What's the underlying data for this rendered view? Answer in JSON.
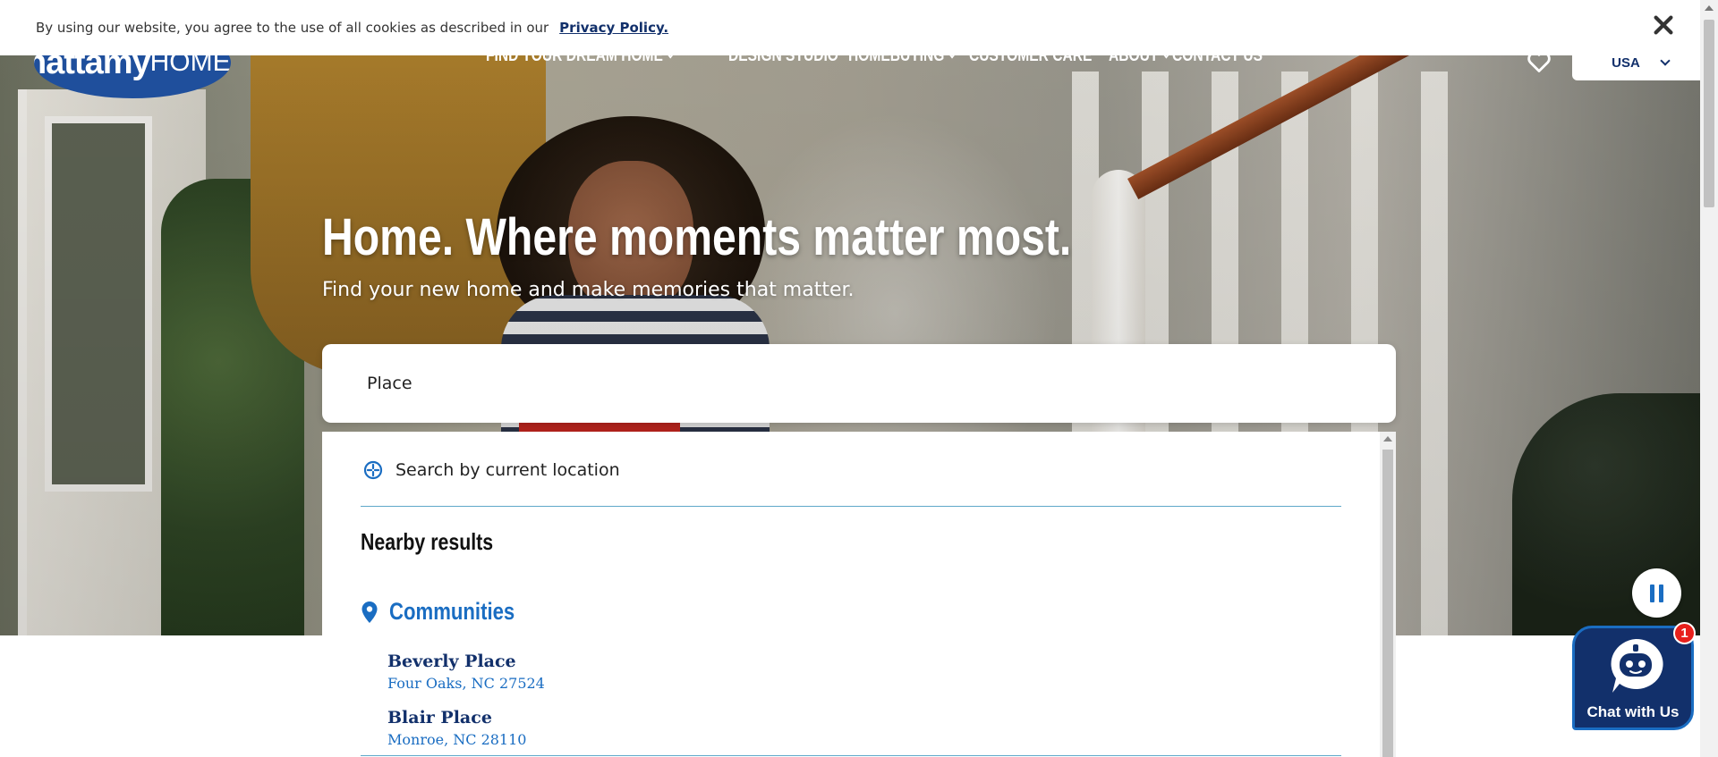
{
  "cookie_bar": {
    "message": "By using our website, you agree to the use of all cookies as described in our",
    "link_text": "Privacy Policy."
  },
  "header": {
    "logo_text_main": "mattamy",
    "logo_text_sub": "HOMES",
    "nav": [
      {
        "label": "FIND YOUR DREAM HOME",
        "has_dropdown": true
      },
      {
        "label": "DESIGN STUDIO",
        "has_dropdown": false
      },
      {
        "label": "HOMEBUYING",
        "has_dropdown": true
      },
      {
        "label": "CUSTOMER CARE",
        "has_dropdown": false
      },
      {
        "label": "ABOUT",
        "has_dropdown": true
      },
      {
        "label": "CONTACT US",
        "has_dropdown": false
      }
    ],
    "country": "USA"
  },
  "hero": {
    "title": "Home. Where moments matter most.",
    "subtitle": "Find your new home and make memories that matter."
  },
  "search": {
    "value": "Place"
  },
  "dropdown": {
    "current_location": "Search by current location",
    "nearby_heading": "Nearby results",
    "communities_heading": "Communities",
    "results": [
      {
        "name": "Beverly Place",
        "address": "Four Oaks, NC 27524"
      },
      {
        "name": "Blair Place",
        "address": "Monroe, NC 28110"
      }
    ]
  },
  "chat": {
    "label": "Chat with Us",
    "badge": "1"
  },
  "colors": {
    "brand_navy": "#12306b",
    "accent_blue": "#1a6dc2",
    "badge_red": "#e8201c",
    "divider": "#5fa8c9"
  }
}
